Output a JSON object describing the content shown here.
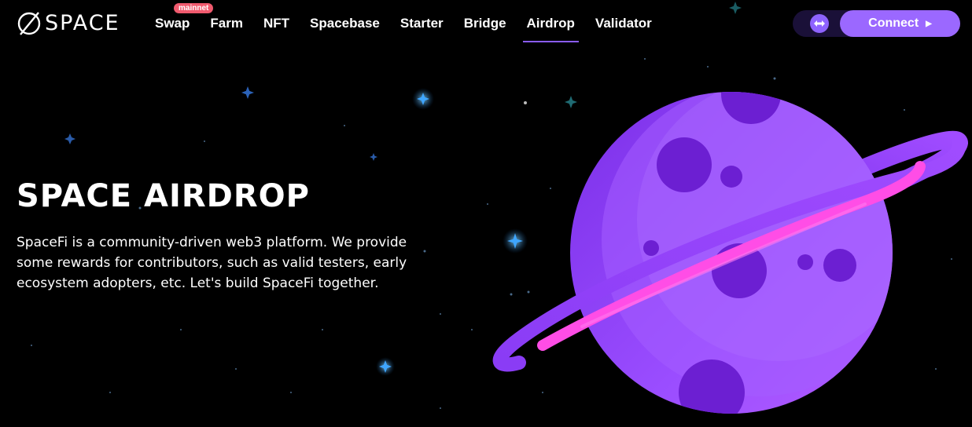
{
  "brand": {
    "name": "SPACE"
  },
  "nav": {
    "items": [
      {
        "label": "Swap",
        "badge": "mainnet"
      },
      {
        "label": "Farm"
      },
      {
        "label": "NFT"
      },
      {
        "label": "Spacebase"
      },
      {
        "label": "Starter"
      },
      {
        "label": "Bridge"
      },
      {
        "label": "Airdrop",
        "active": true
      },
      {
        "label": "Validator"
      }
    ]
  },
  "controls": {
    "network_icon": "swap-arrows-icon",
    "connect_label": "Connect",
    "connect_icon": "play-arrow-icon"
  },
  "hero": {
    "title": "SPACE AIRDROP",
    "description": "SpaceFi is a community-driven web3 platform. We provide some rewards for contributors, such as valid testers, early ecosystem adopters, etc. Let's build SpaceFi together."
  },
  "colors": {
    "accent": "#9b68ff",
    "badge": "#f05a6e",
    "planet": "#8a3cf5",
    "ring": "#ff4de6",
    "star": "#3fa6ff"
  }
}
